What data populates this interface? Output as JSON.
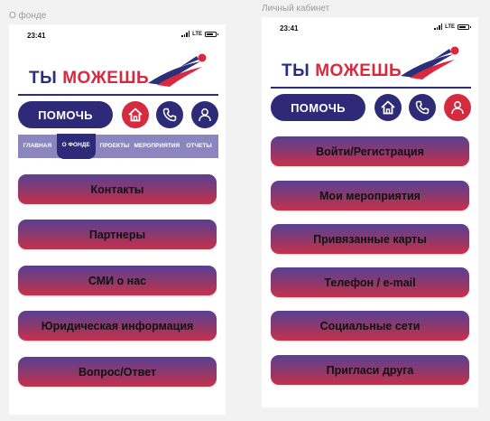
{
  "frames": {
    "left_label": "О фонде",
    "right_label": "Личный кабинет"
  },
  "status": {
    "time": "23:41",
    "network": "LTE"
  },
  "logo": {
    "word1": "ТЫ",
    "word2": "МОЖЕШЬ"
  },
  "header": {
    "help_label": "ПОМОЧЬ"
  },
  "tabs": [
    {
      "label": "ГЛАВНАЯ",
      "active": false
    },
    {
      "label": "О ФОНДЕ",
      "active": true
    },
    {
      "label": "ПРОЕКТЫ",
      "active": false
    },
    {
      "label": "МЕРОПРИЯТИЯ",
      "active": false
    },
    {
      "label": "ОТЧЕТЫ",
      "active": false
    }
  ],
  "about_menu": [
    "Контакты",
    "Партнеры",
    "СМИ о нас",
    "Юридическая информация",
    "Вопрос/Ответ"
  ],
  "cabinet_menu": [
    "Войти/Регистрация",
    "Мои мероприятия",
    "Привязанные карты",
    "Телефон / e-mail",
    "Социальные сети",
    "Пригласи друга"
  ],
  "colors": {
    "navy": "#2e2a78",
    "red": "#d42b3f",
    "tabs_bg": "#8b86c0"
  },
  "icons": [
    "home-icon",
    "phone-icon",
    "user-icon",
    "runner-logo-icon"
  ]
}
